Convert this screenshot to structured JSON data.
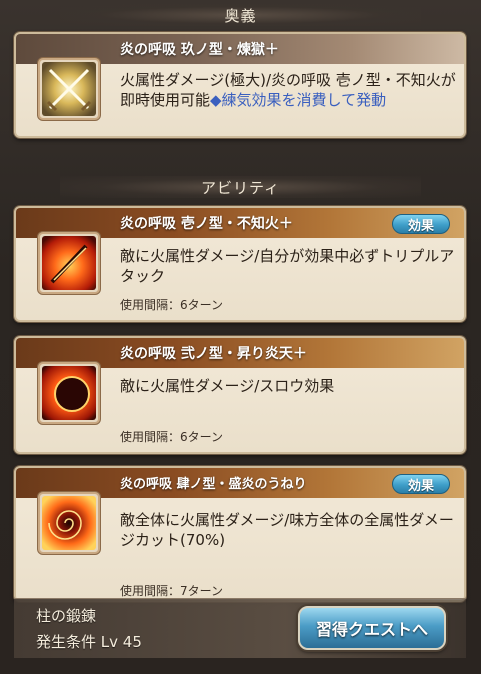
{
  "ougi_section": {
    "header": "奥義",
    "card": {
      "title": "炎の呼吸 玖ノ型・煉獄＋",
      "description_main": "火属性ダメージ(極大)/炎の呼吸 壱ノ型・不知火が即時使用可能",
      "description_link": "◆練気効果を消費して発動",
      "icon": "crossed-swords-icon"
    }
  },
  "ability_section": {
    "header": "アビリティ",
    "cards": [
      {
        "title": "炎の呼吸 壱ノ型・不知火＋",
        "badge": "効果",
        "description": "敵に火属性ダメージ/自分が効果中必ずトリプルアタック",
        "cooldown": "使用間隔：6ターン",
        "icon": "flame-sword-icon"
      },
      {
        "title": "炎の呼吸 弐ノ型・昇り炎天＋",
        "description": "敵に火属性ダメージ/スロウ効果",
        "cooldown": "使用間隔：6ターン",
        "icon": "flame-crescent-icon"
      },
      {
        "title": "炎の呼吸 肆ノ型・盛炎のうねり",
        "badge": "効果",
        "description": "敵全体に火属性ダメージ/味方全体の全属性ダメージカット(70%)",
        "cooldown": "使用間隔：7ターン",
        "icon": "flame-vortex-icon"
      }
    ]
  },
  "footer": {
    "line1": "柱の鍛錬",
    "line2": "発生条件 Lv 45",
    "quest_button": "習得クエストへ"
  },
  "colors": {
    "title_bar_fire": "#8a4c22",
    "badge_blue": "#3e9ec9",
    "link_blue": "#3a5fbf",
    "card_bg": "#f2e9d8"
  }
}
